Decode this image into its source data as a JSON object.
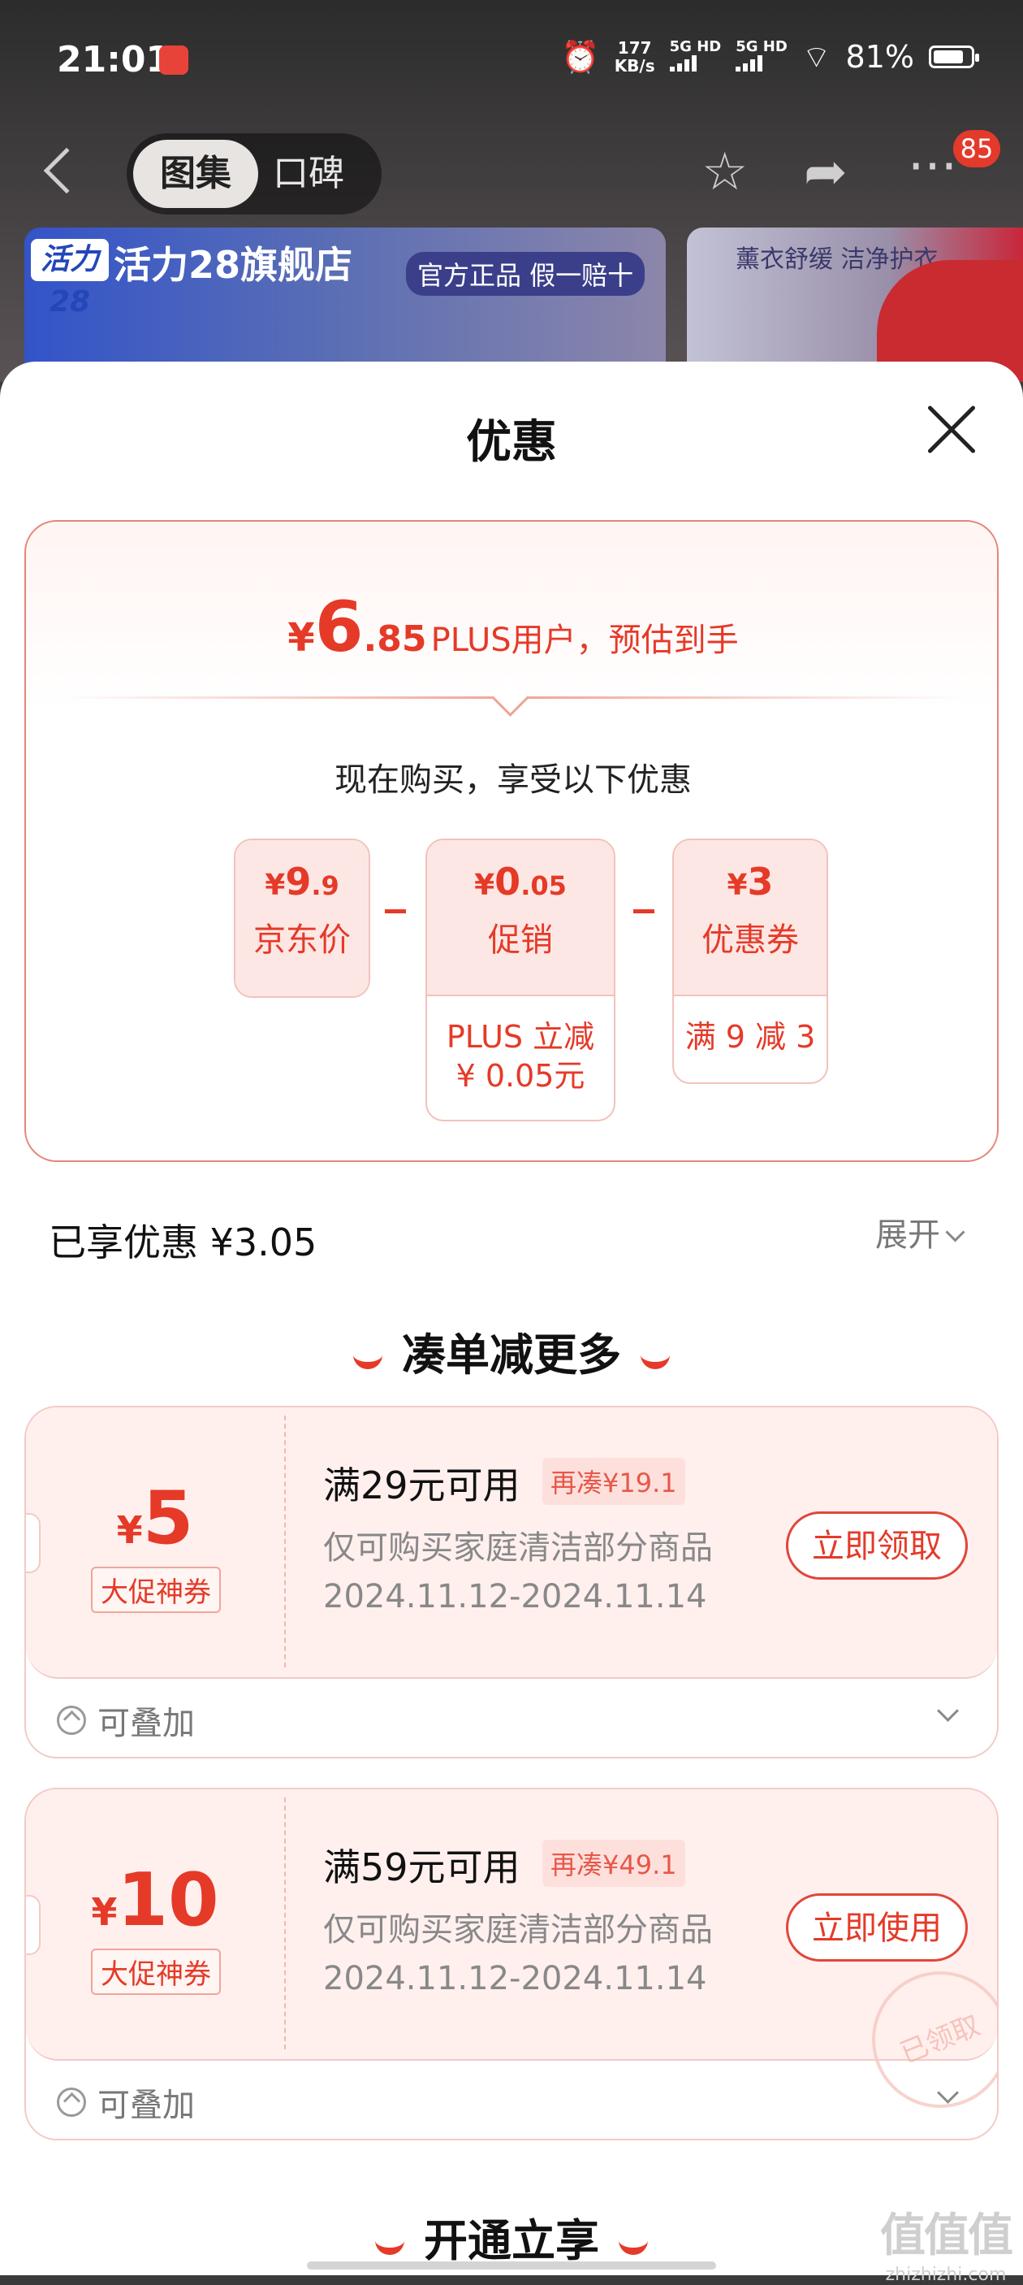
{
  "status_bar": {
    "time": "21:01",
    "net_speed_value": "177",
    "net_speed_unit": "KB/s",
    "sim1": "5G HD",
    "sim2": "5G HD",
    "battery": "81%",
    "battery_level": 0.81
  },
  "nav": {
    "tabs": [
      {
        "label": "图集"
      },
      {
        "label": "口碑"
      }
    ],
    "message_badge": "85",
    "icons": [
      "back-icon",
      "star-icon",
      "share-icon",
      "more-icon"
    ]
  },
  "background_banner": {
    "store_logo": "活力28",
    "store_name": "活力28旗舰店",
    "tag": "官方正品 假一赔十",
    "right_text": "薰衣舒缓 洁净护衣"
  },
  "sheet": {
    "title": "优惠",
    "estimate": {
      "currency": "¥",
      "integer": "6",
      "decimal": ".85",
      "text": "PLUS用户，预估到手"
    },
    "buy_now": "现在购买，享受以下优惠",
    "breakdown": [
      {
        "amount_int": "9",
        "amount_dec": ".9",
        "label": "京东价",
        "note_lines": []
      },
      {
        "amount_int": "0",
        "amount_dec": ".05",
        "label": "促销",
        "note_lines": [
          "PLUS 立减",
          "¥ 0.05元"
        ]
      },
      {
        "amount_int": "3",
        "amount_dec": "",
        "label": "优惠券",
        "note_lines": [
          "满 9 减 3"
        ]
      }
    ],
    "enjoyed": "已享优惠 ¥3.05",
    "expand": "展开",
    "section_more": "凑单减更多",
    "coupons": [
      {
        "value": "5",
        "tag": "大促神券",
        "condition": "满29元可用",
        "add_more": "再凑¥19.1",
        "scope": "仅可购买家庭清洁部分商品",
        "date": "2024.11.12-2024.11.14",
        "button": "立即领取",
        "stamp": "",
        "footer": "可叠加"
      },
      {
        "value": "10",
        "tag": "大促神券",
        "condition": "满59元可用",
        "add_more": "再凑¥49.1",
        "scope": "仅可购买家庭清洁部分商品",
        "date": "2024.11.12-2024.11.14",
        "button": "立即使用",
        "stamp": "已领取",
        "footer": "可叠加"
      }
    ],
    "section_plus": "开通立享"
  },
  "watermark": {
    "main": "值值值",
    "sub": "zhizhizhi.com"
  },
  "colors": {
    "accent": "#e53a28",
    "coupon_bg": "#fff0ee",
    "border": "#f1cbc5"
  }
}
